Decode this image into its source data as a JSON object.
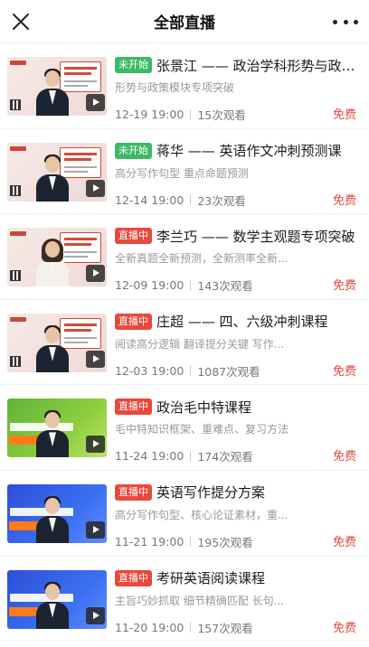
{
  "header": {
    "title": "全部直播"
  },
  "courses": [
    {
      "status": "未开始",
      "status_type": "soon",
      "title": "张景江 —— 政治学科形势与政策...",
      "desc": "形势与政策模块专项突破",
      "date": "12-19 19:00",
      "views": "15次观看",
      "price": "免费",
      "thumb_style": "pink",
      "person": "male"
    },
    {
      "status": "未开始",
      "status_type": "soon",
      "title": "蒋华 —— 英语作文冲刺预测课",
      "desc": "高分写作句型 重点命题预测",
      "date": "12-14 19:00",
      "views": "23次观看",
      "price": "免费",
      "thumb_style": "pink",
      "person": "male"
    },
    {
      "status": "直播中",
      "status_type": "live",
      "title": "李兰巧 —— 数学主观题专项突破",
      "desc": "全新真题全新预测，全新测率全新...",
      "date": "12-09 19:00",
      "views": "143次观看",
      "price": "免费",
      "thumb_style": "pink",
      "person": "female"
    },
    {
      "status": "直播中",
      "status_type": "live",
      "title": "庄超 —— 四、六级冲刺课程",
      "desc": "阅读高分逻辑 翻译提分关键 写作...",
      "date": "12-03 19:00",
      "views": "1087次观看",
      "price": "免费",
      "thumb_style": "pink",
      "person": "male"
    },
    {
      "status": "直播中",
      "status_type": "live",
      "title": "政治毛中特课程",
      "desc": "毛中特知识框架、重难点、复习方法",
      "date": "11-24 19:00",
      "views": "174次观看",
      "price": "免费",
      "thumb_style": "green",
      "person": "male"
    },
    {
      "status": "直播中",
      "status_type": "live",
      "title": "英语写作提分方案",
      "desc": "高分写作句型、核心论证素材，重...",
      "date": "11-21 19:00",
      "views": "195次观看",
      "price": "免费",
      "thumb_style": "blue",
      "person": "male"
    },
    {
      "status": "直播中",
      "status_type": "live",
      "title": "考研英语阅读课程",
      "desc": "主旨巧妙抓取 细节精确匹配 长句...",
      "date": "11-20 19:00",
      "views": "157次观看",
      "price": "免费",
      "thumb_style": "blue",
      "person": "male"
    }
  ],
  "colors": {
    "soon_badge": "#3cb964",
    "live_badge": "#e8493d",
    "price": "#e8493d"
  },
  "icons": {
    "close": "close-icon",
    "more": "more-icon",
    "play": "play-icon"
  }
}
